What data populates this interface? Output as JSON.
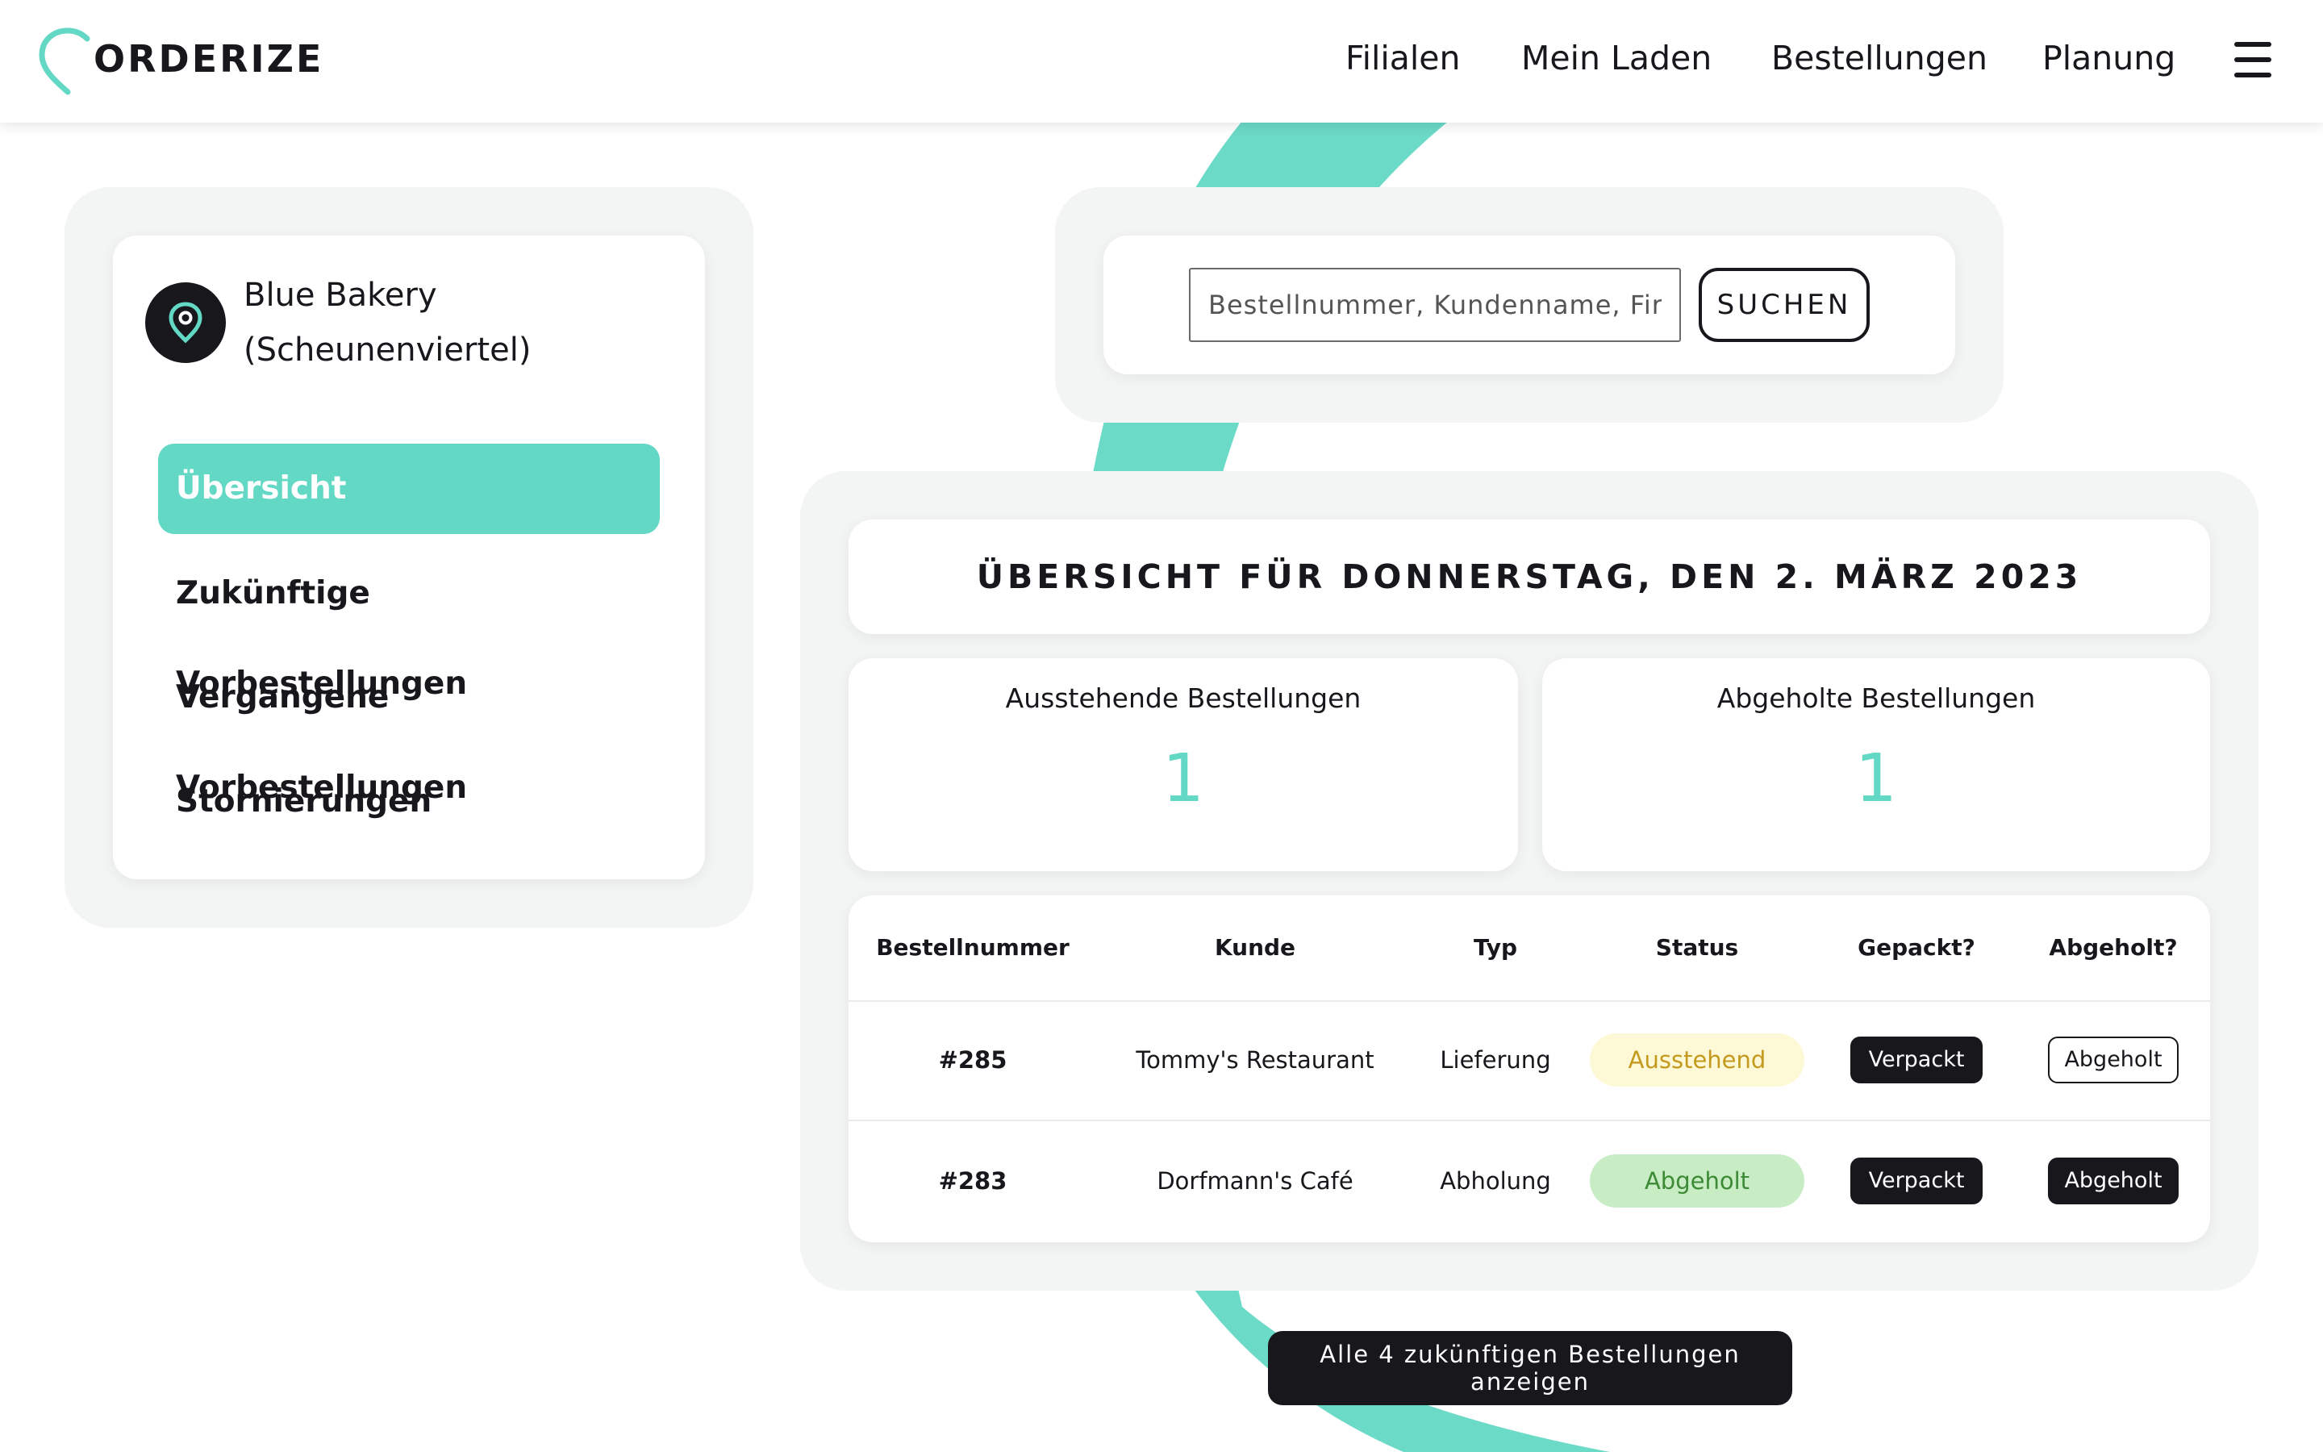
{
  "brand": {
    "name": "ORDERIZE",
    "accent_color": "#63d8c4",
    "dark_color": "#17171c"
  },
  "nav": {
    "items": [
      {
        "label": "Filialen"
      },
      {
        "label": "Mein Laden"
      },
      {
        "label": "Bestellungen"
      },
      {
        "label": "Planung"
      }
    ],
    "menu_icon": "hamburger-menu-icon"
  },
  "sidebar": {
    "store": {
      "name_line1": "Blue Bakery",
      "name_line2": "(Scheunenviertel)",
      "icon": "location-pin-icon"
    },
    "items": [
      {
        "label": "Übersicht",
        "active": true
      },
      {
        "label": "Zukünftige Vorbestellungen",
        "active": false
      },
      {
        "label": "Vergangene Vorbestellungen",
        "active": false
      },
      {
        "label": "Stornierungen",
        "active": false
      }
    ]
  },
  "search": {
    "placeholder": "Bestellnummer, Kundenname, Firme",
    "value": "",
    "button_label": "SUCHEN"
  },
  "overview": {
    "title": "ÜBERSICHT FÜR DONNERSTAG, DEN 2. MÄRZ 2023",
    "stats": [
      {
        "label": "Ausstehende Bestellungen",
        "value": "1"
      },
      {
        "label": "Abgeholte Bestellungen",
        "value": "1"
      }
    ]
  },
  "orders": {
    "columns": [
      "Bestellnummer",
      "Kunde",
      "Typ",
      "Status",
      "Gepackt?",
      "Abgeholt?"
    ],
    "rows": [
      {
        "number": "#285",
        "customer": "Tommy's Restaurant",
        "type": "Lieferung",
        "status": "Ausstehend",
        "status_bg": "#fdf8d6",
        "status_color": "#c49a1e",
        "packed": "Verpackt",
        "packed_active": true,
        "picked": "Abgeholt",
        "picked_active": false
      },
      {
        "number": "#283",
        "customer": "Dorfmann's Café",
        "type": "Abholung",
        "status": "Abgeholt",
        "status_bg": "#c8edc4",
        "status_color": "#3d8a36",
        "packed": "Verpackt",
        "packed_active": true,
        "picked": "Abgeholt",
        "picked_active": true
      }
    ]
  },
  "footer_button": {
    "label": "Alle 4 zukünftigen Bestellungen anzeigen"
  }
}
